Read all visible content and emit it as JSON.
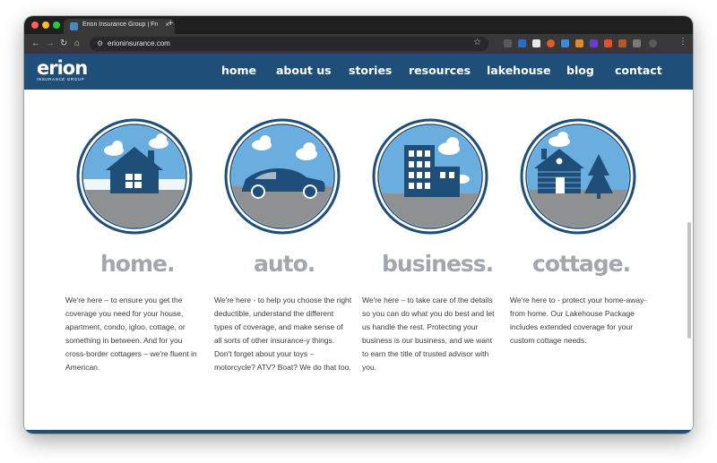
{
  "browser": {
    "tab_title": "Erion Insurance Group | Fron",
    "tab_close": "×",
    "new_tab": "+",
    "url": "erioninsurance.com",
    "star": "☆",
    "menu": "⋮",
    "colors": {
      "red": "#fe5f57",
      "yellow": "#febc2e",
      "green": "#28c840"
    }
  },
  "site": {
    "logo_word": "erion",
    "logo_sub": "INSURANCE GROUP",
    "brand_color": "#1f4e78",
    "nav": [
      "home",
      "about us",
      "stories",
      "resources",
      "lakehouse",
      "blog",
      "contact"
    ]
  },
  "products": [
    {
      "title": "home.",
      "icon": "house-icon",
      "description": "We're here – to ensure you get the coverage you need for your house, apartment, condo, igloo, cottage, or something in between. And for you cross-border cottagers – we're fluent in American."
    },
    {
      "title": "auto.",
      "icon": "car-icon",
      "description": "We're here - to help you choose the right deductible, understand the different types of coverage, and make sense of all sorts of other insurance-y things. Don't forget about your toys – motorcycle? ATV? Boat? We do that too."
    },
    {
      "title": "business.",
      "icon": "building-icon",
      "description": "We're here – to take care of the details so you can do what you do best and let us handle the rest. Protecting your business is our business, and we want to earn the title of trusted advisor with you."
    },
    {
      "title": "cottage.",
      "icon": "cabin-icon",
      "description": "We're here to - protect your home-away-from home. Our Lakehouse Package includes extended coverage for your custom cottage needs."
    }
  ]
}
